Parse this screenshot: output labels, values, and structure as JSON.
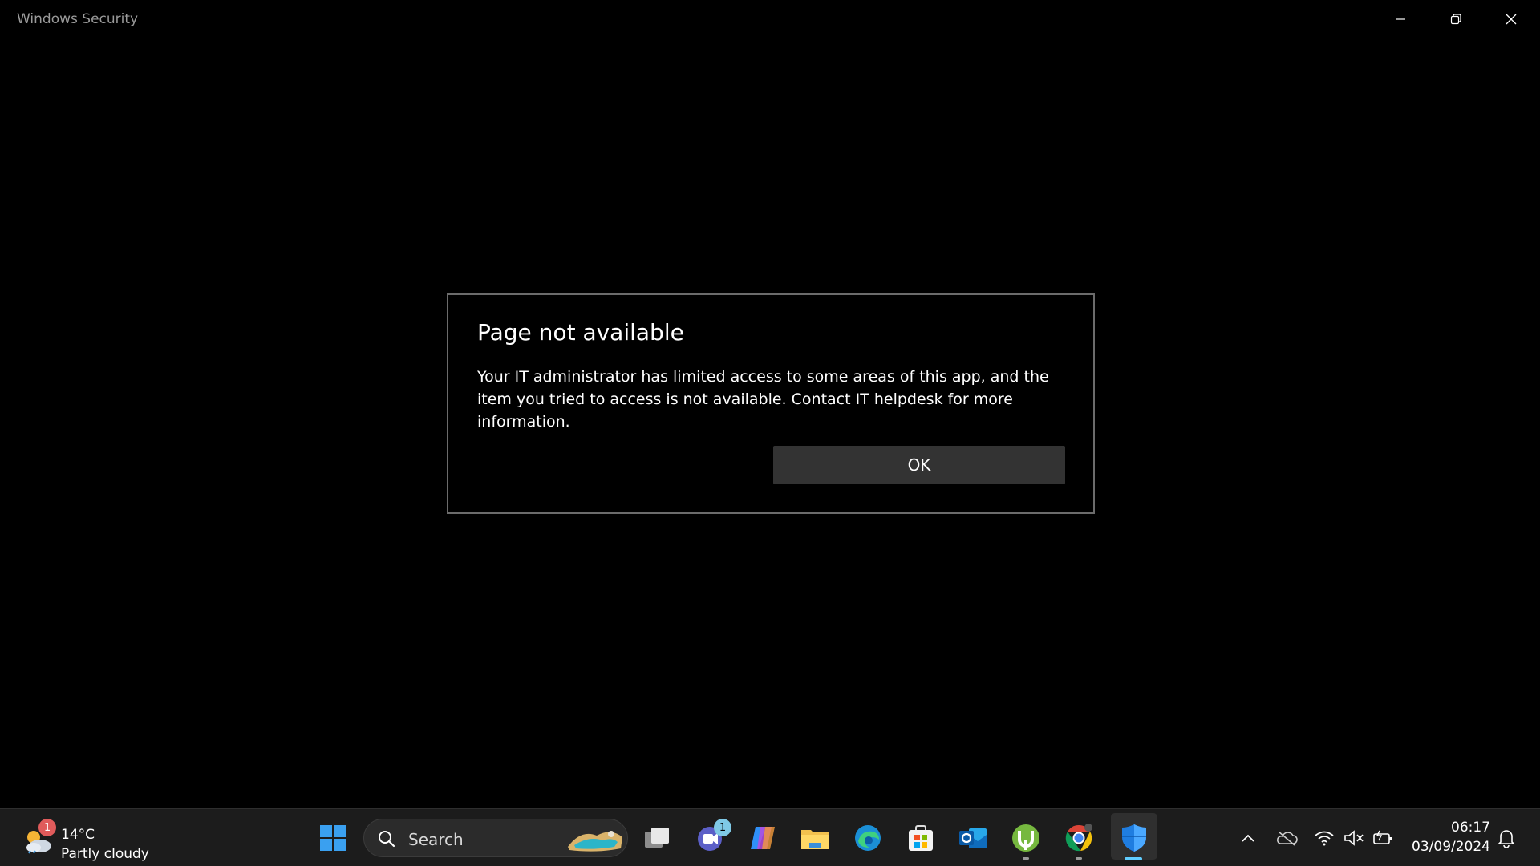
{
  "window": {
    "title": "Windows Security",
    "controls": [
      "minimize-icon",
      "restore-icon",
      "close-icon"
    ]
  },
  "dialog": {
    "title": "Page not available",
    "body": "Your IT administrator has limited access to some areas of this app, and the item you tried to access is not available. Contact IT helpdesk for more information.",
    "ok_label": "OK"
  },
  "taskbar": {
    "weather": {
      "temperature": "14°C",
      "condition": "Partly cloudy",
      "badge": "1",
      "icon": "partly-cloudy-icon"
    },
    "search": {
      "label": "Search"
    },
    "apps": [
      {
        "name": "start",
        "icon": "windows-logo-icon"
      },
      {
        "name": "task-view",
        "icon": "task-view-icon"
      },
      {
        "name": "teams",
        "icon": "teams-icon",
        "badge": "1"
      },
      {
        "name": "copilot",
        "icon": "copilot-icon"
      },
      {
        "name": "file-explorer",
        "icon": "folder-icon"
      },
      {
        "name": "edge",
        "icon": "edge-icon"
      },
      {
        "name": "microsoft-store",
        "icon": "store-icon"
      },
      {
        "name": "outlook",
        "icon": "outlook-icon"
      },
      {
        "name": "utorrent",
        "icon": "utorrent-icon"
      },
      {
        "name": "chrome",
        "icon": "chrome-icon"
      },
      {
        "name": "windows-security",
        "icon": "shield-icon"
      }
    ],
    "tray": {
      "icons": [
        "chevron-up-icon",
        "onedrive-offline-icon",
        "wifi-icon",
        "speaker-muted-icon",
        "battery-icon"
      ],
      "time": "06:17",
      "date": "03/09/2024"
    },
    "colors": {
      "accent": "#60cdff",
      "taskbar_bg": "#1c1c1c",
      "dialog_button_bg": "#333333"
    }
  }
}
